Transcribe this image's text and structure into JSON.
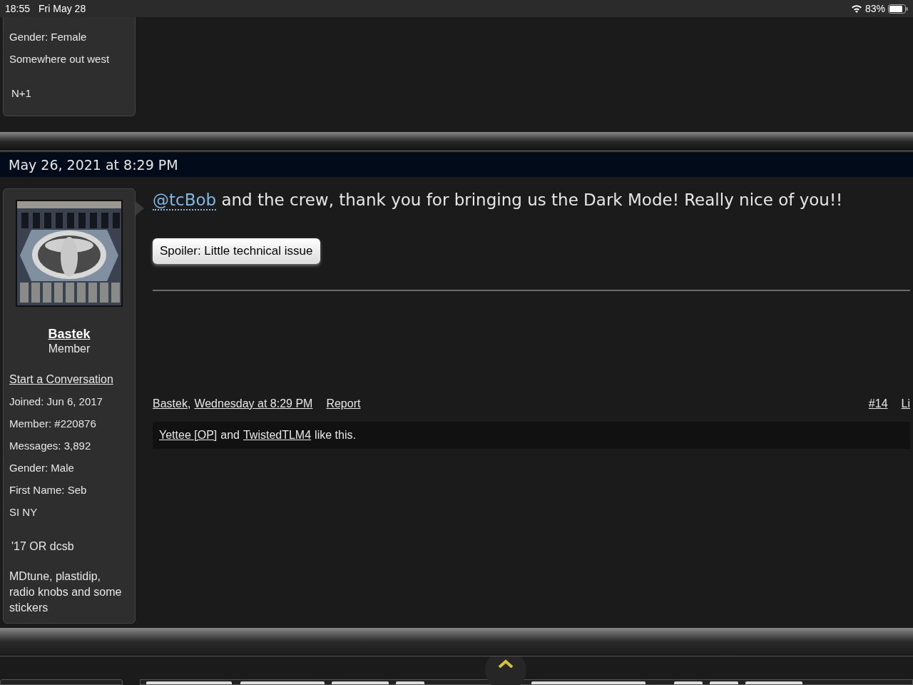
{
  "status_bar": {
    "time": "18:55",
    "date": "Fri May 28",
    "battery": "83%"
  },
  "previous_post": {
    "user_info": [
      {
        "text": "Gender:  Female"
      },
      {
        "text": "Somewhere out west"
      },
      {
        "text": "N+1"
      }
    ]
  },
  "post": {
    "date": "May 26, 2021 at 8:29 PM",
    "user": {
      "name": "Bastek",
      "role": "Member",
      "start_conversation": "Start a Conversation",
      "info": [
        {
          "text": "Joined:  Jun 6, 2017"
        },
        {
          "text": "Member:  #220876"
        },
        {
          "text": "Messages:  3,892"
        },
        {
          "text": "Gender:  Male"
        },
        {
          "text": "First Name: Seb"
        },
        {
          "text": "SI NY"
        }
      ],
      "signature": [
        {
          "text": "'17 OR dcsb"
        },
        {
          "text": "MDtune, plastidip, radio knobs and some stickers"
        }
      ]
    },
    "mention": "@tcBob",
    "message": "and the crew, thank you for bringing us the Dark Mode! Really nice of you!!",
    "spoiler_button": "Spoiler: Little technical issue",
    "footer": {
      "author": "Bastek",
      "separator": ",",
      "time": "Wednesday at 8:29 PM",
      "report": "Report",
      "number": "#14",
      "like": "Li"
    },
    "likes": {
      "users": [
        "Yettee [OP]",
        "TwistedTLM4"
      ],
      "joiner": "and",
      "suffix": "like this."
    }
  },
  "page_tabs": [
    {
      "selected": false
    },
    {
      "selected": false
    },
    {
      "selected": false
    },
    {
      "selected": false
    },
    {
      "selected": false
    },
    {
      "selected": false
    },
    {
      "selected": false
    },
    {
      "selected": false
    }
  ]
}
